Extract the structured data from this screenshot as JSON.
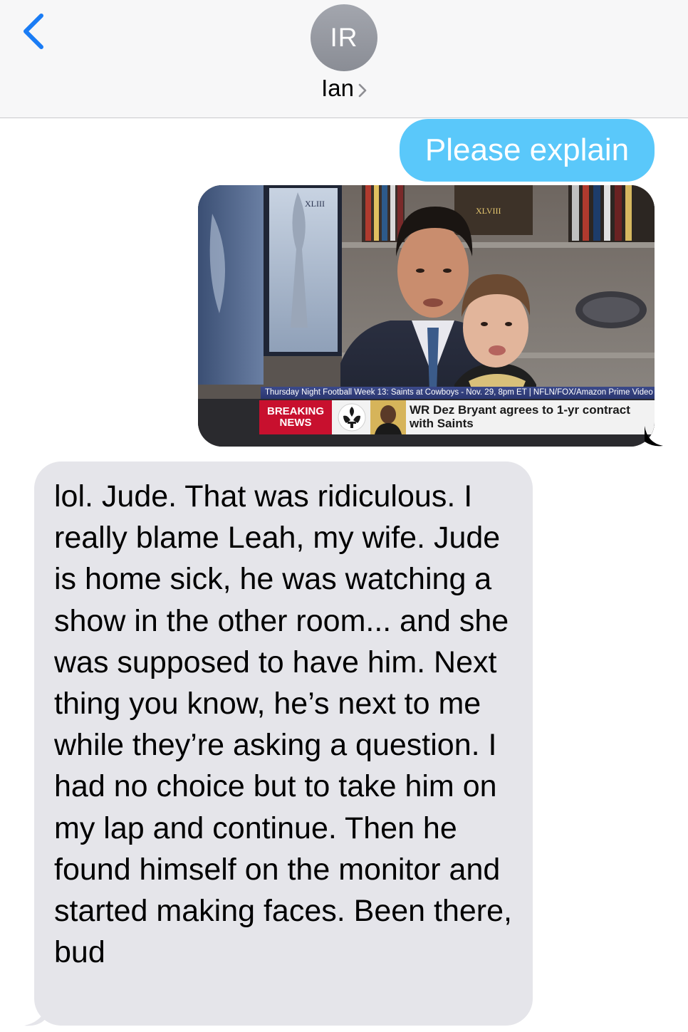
{
  "header": {
    "back_label": "",
    "avatar_initials": "IR",
    "contact_name": "Ian"
  },
  "thread": {
    "sent_text": "Please explain",
    "image_message": {
      "ticker": "Thursday Night Football Week 13: Saints at Cowboys - Nov. 29, 8pm ET | NFLN/FOX/Amazon Prime Video",
      "breaking_line1": "BREAKING",
      "breaking_line2": "NEWS",
      "headline_line1": "WR Dez Bryant agrees to 1-yr contract",
      "headline_line2": "with Saints",
      "trophy_text": "XLIII",
      "shelf_text": "XLVIII"
    },
    "received_text": "lol. Jude. That was ridiculous. I really blame Leah, my wife. Jude is home sick, he was watching a show in the other room... and she was supposed to have him. Next thing you know, he’s next to me while they’re asking a question. I had no choice but to take him on my lap and continue. Then he found himself on the monitor and started making faces. Been there, bud"
  },
  "colors": {
    "sent_bubble": "#5ac8fa",
    "received_bubble": "#e5e5ea",
    "accent_blue": "#1a7cf5",
    "header_bg": "#f7f7f8",
    "avatar": "#9a9da5"
  },
  "icons": {
    "back": "chevron-left-icon",
    "contact_detail": "chevron-right-icon"
  }
}
